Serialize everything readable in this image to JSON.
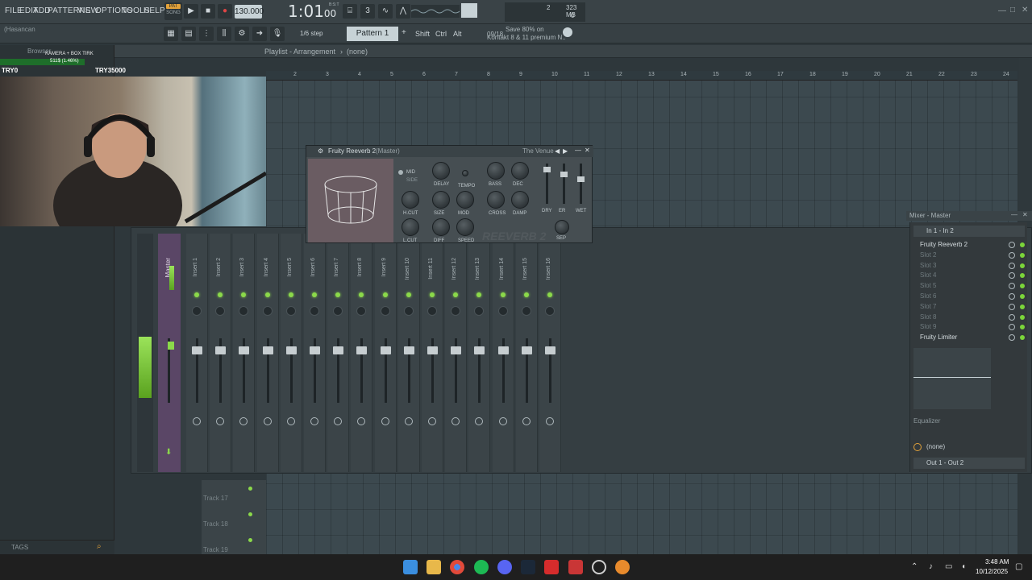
{
  "menu": [
    "FILE",
    "EDIT",
    "ADD",
    "PATTERNS",
    "VIEW",
    "OPTIONS",
    "TOOLS",
    "HELP"
  ],
  "transport": {
    "pat": "PAT",
    "song": "SONG",
    "tempo": "130.000",
    "time": "1:01",
    "time_sub": "00",
    "time_unit": "B:S:T"
  },
  "meters": {
    "cpu": "2",
    "ram": "323 MB",
    "voices": "0"
  },
  "toolbar": {
    "step": "1/6 step",
    "pattern": "Pattern 1",
    "shift": "Shift",
    "ctrl": "Ctrl",
    "alt": "Alt"
  },
  "news": {
    "date": "09/18",
    "line1": "Save 80% on",
    "line2": "Kontakt 8 & 11 premium N.."
  },
  "user": {
    "name": "(Hasancan"
  },
  "overlay": {
    "top": "KAMERA + BOX TIRK",
    "stat": "511$ (1.46%)",
    "left": "TRY0",
    "right": "TRY35000"
  },
  "playlist": {
    "title": "Playlist - Arrangement",
    "sep": "›",
    "pattern": "(none)"
  },
  "ruler": [
    "2",
    "3",
    "4",
    "5",
    "6",
    "7",
    "8",
    "9",
    "10",
    "11",
    "12",
    "13",
    "14",
    "15",
    "16",
    "17",
    "18",
    "19",
    "20",
    "21",
    "22",
    "23",
    "24"
  ],
  "tracks": [
    "Track 17",
    "Track 18",
    "Track 19"
  ],
  "mixer": {
    "title": "Mixer - Master",
    "master": "Master",
    "inserts": [
      "Insert 1",
      "Insert 2",
      "Insert 3",
      "Insert 4",
      "Insert 5",
      "Insert 6",
      "Insert 7",
      "Insert 8",
      "Insert 9",
      "Insert 10",
      "Insert 11",
      "Insert 12",
      "Insert 13",
      "Insert 14",
      "Insert 15",
      "Insert 16"
    ],
    "input": "In 1 - In 2",
    "slots": [
      "Fruity Reeverb 2",
      "Slot 2",
      "Slot 3",
      "Slot 4",
      "Slot 5",
      "Slot 6",
      "Slot 7",
      "Slot 8",
      "Slot 9",
      "Fruity Limiter"
    ],
    "equalizer": "Equalizer",
    "none": "(none)",
    "output": "Out 1 - Out 2"
  },
  "reverb": {
    "title": "Fruity Reeverb 2",
    "target": "(Master)",
    "preset": "The Venue",
    "mid": "MID",
    "side": "SIDE",
    "knobs": [
      "DELAY",
      "TEMPO",
      "BASS",
      "DEC",
      "H.CUT",
      "SIZE",
      "MOD",
      "CROSS",
      "DAMP",
      "L.CUT",
      "DIFF",
      "SPEED"
    ],
    "faders": [
      "DRY",
      "ER",
      "WET"
    ],
    "sep": "SEP",
    "logo": "REEVERB 2"
  },
  "browser": {
    "label": "Browser",
    "tags": "TAGS"
  },
  "clock": {
    "time": "3:48 AM",
    "date": "10/12/2025"
  },
  "accent": "#8bd94a"
}
